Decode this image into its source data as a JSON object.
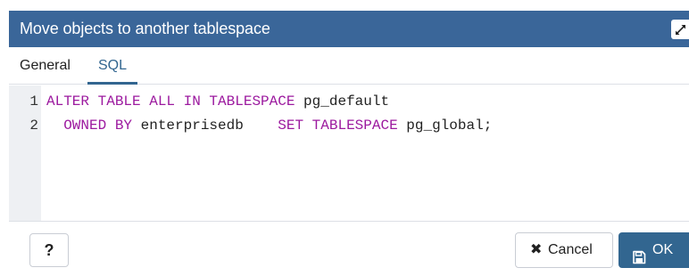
{
  "dialog": {
    "title": "Move objects to another tablespace",
    "maximize_icon": "maximize-icon"
  },
  "tabs": [
    {
      "label": "General",
      "active": false
    },
    {
      "label": "SQL",
      "active": true
    }
  ],
  "editor": {
    "line_numbers": [
      "1",
      "2"
    ],
    "lines": [
      [
        {
          "text": "ALTER TABLE ALL IN TABLESPACE",
          "type": "keyword"
        },
        {
          "text": " pg_default",
          "type": "plain"
        }
      ],
      [
        {
          "text": "  OWNED BY",
          "type": "keyword"
        },
        {
          "text": " enterprisedb    ",
          "type": "plain"
        },
        {
          "text": "SET TABLESPACE",
          "type": "keyword"
        },
        {
          "text": " pg_global;",
          "type": "plain"
        }
      ]
    ]
  },
  "footer": {
    "help_label": "?",
    "cancel_label": "Cancel",
    "cancel_icon": "close-icon",
    "ok_label": "OK",
    "ok_icon": "save-icon"
  },
  "colors": {
    "titlebar": "#3a6699",
    "primary": "#326690",
    "keyword": "#9c1a9f",
    "gutter": "#eef0f3"
  }
}
